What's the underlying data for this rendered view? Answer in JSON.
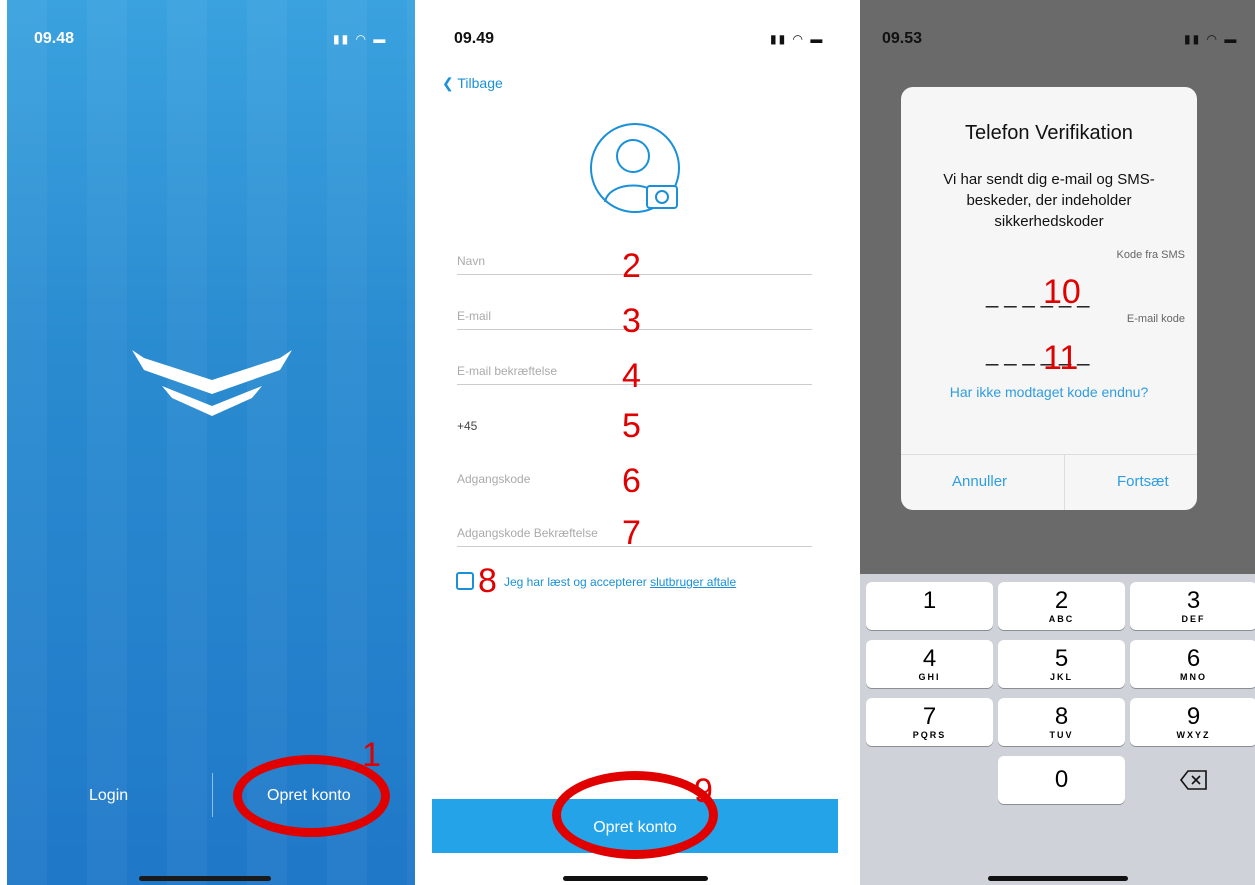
{
  "phone1": {
    "time": "09.48",
    "login_label": "Login",
    "create_account_label": "Opret konto",
    "marker": "1"
  },
  "phone2": {
    "time": "09.49",
    "back_label": "Tilbage",
    "fields": [
      {
        "placeholder": "Navn",
        "marker": "2"
      },
      {
        "placeholder": "E-mail",
        "marker": "3"
      },
      {
        "placeholder": "E-mail bekræftelse",
        "marker": "4"
      },
      {
        "placeholder": "+45",
        "marker": "5"
      },
      {
        "placeholder": "Adgangskode",
        "marker": "6"
      },
      {
        "placeholder": "Adgangskode Bekræftelse",
        "marker": "7"
      }
    ],
    "agree_text": "Jeg har læst og accepterer",
    "agree_link": "slutbruger aftale",
    "agree_marker": "8",
    "submit_label": "Opret konto",
    "submit_marker": "9"
  },
  "phone3": {
    "time": "09.53",
    "dialog_title": "Telefon Verifikation",
    "dialog_message": "Vi har sendt dig e-mail og SMS-beskeder, der indeholder sikkerhedskoder",
    "sms_label": "Kode fra SMS",
    "sms_code": "______",
    "sms_marker": "10",
    "email_label": "E-mail kode",
    "email_code": "______",
    "email_marker": "11",
    "resend_link": "Har ikke modtaget kode endnu?",
    "cancel_label": "Annuller",
    "continue_label": "Fortsæt",
    "keys": [
      {
        "num": "1",
        "letters": ""
      },
      {
        "num": "2",
        "letters": "ABC"
      },
      {
        "num": "3",
        "letters": "DEF"
      },
      {
        "num": "4",
        "letters": "GHI"
      },
      {
        "num": "5",
        "letters": "JKL"
      },
      {
        "num": "6",
        "letters": "MNO"
      },
      {
        "num": "7",
        "letters": "PQRS"
      },
      {
        "num": "8",
        "letters": "TUV"
      },
      {
        "num": "9",
        "letters": "WXYZ"
      },
      {
        "num": "0",
        "letters": ""
      }
    ]
  }
}
